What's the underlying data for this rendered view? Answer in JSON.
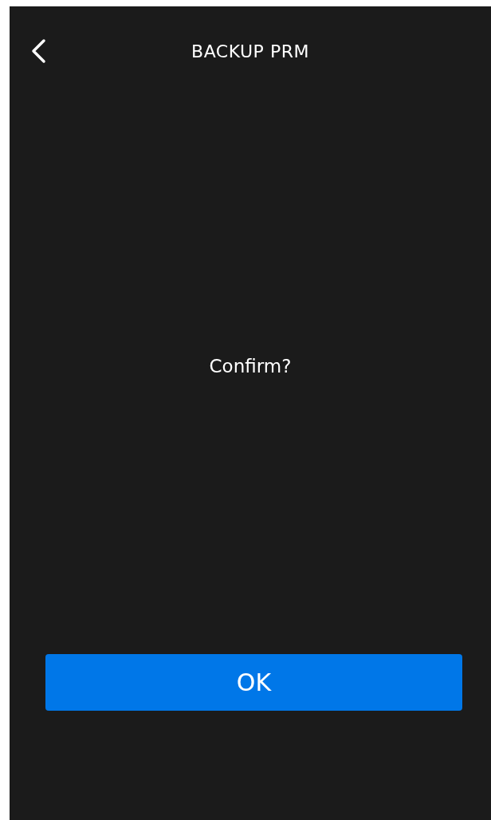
{
  "title": "BACKUP PRM",
  "message": "Confirm?",
  "button": "OK"
}
